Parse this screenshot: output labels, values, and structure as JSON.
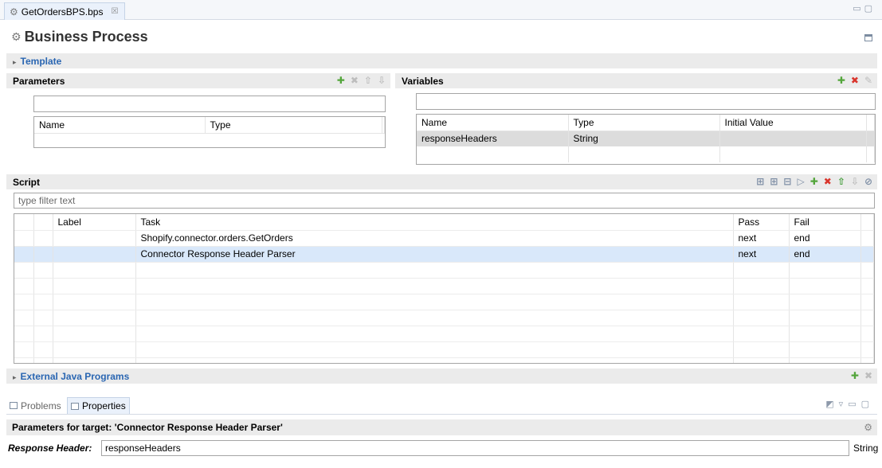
{
  "editor_tab": {
    "title": "GetOrdersBPS.bps",
    "close": "☒"
  },
  "page_title": "Business Process",
  "template": {
    "label": "Template"
  },
  "parameters": {
    "label": "Parameters",
    "columns": [
      "Name",
      "Type"
    ]
  },
  "variables": {
    "label": "Variables",
    "columns": [
      "Name",
      "Type",
      "Initial Value"
    ],
    "rows": [
      {
        "name": "responseHeaders",
        "type": "String",
        "initial": ""
      }
    ]
  },
  "script": {
    "label": "Script",
    "filter_placeholder": "type filter text",
    "columns": [
      "Label",
      "Task",
      "Pass",
      "Fail"
    ],
    "rows": [
      {
        "label": "",
        "task": "Shopify.connector.orders.GetOrders",
        "pass": "next",
        "fail": "end"
      },
      {
        "label": "",
        "task": "Connector Response Header Parser",
        "pass": "next",
        "fail": "end"
      }
    ]
  },
  "external_java": {
    "label": "External Java Programs"
  },
  "bottom_tabs": {
    "problems": "Problems",
    "properties": "Properties"
  },
  "target_header": "Parameters for target: 'Connector Response Header Parser'",
  "response_header": {
    "label": "Response Header:",
    "value": "responseHeaders",
    "type": "String"
  },
  "icons": {
    "gear": "⚙",
    "caret": "▸",
    "plus": "✚",
    "x": "✖",
    "up": "⇧",
    "down": "⇩",
    "cancel": "⊘"
  },
  "colors": {
    "link": "#2a66b2",
    "selection": "#d9e8fa",
    "section_bg": "#ebebeb"
  }
}
